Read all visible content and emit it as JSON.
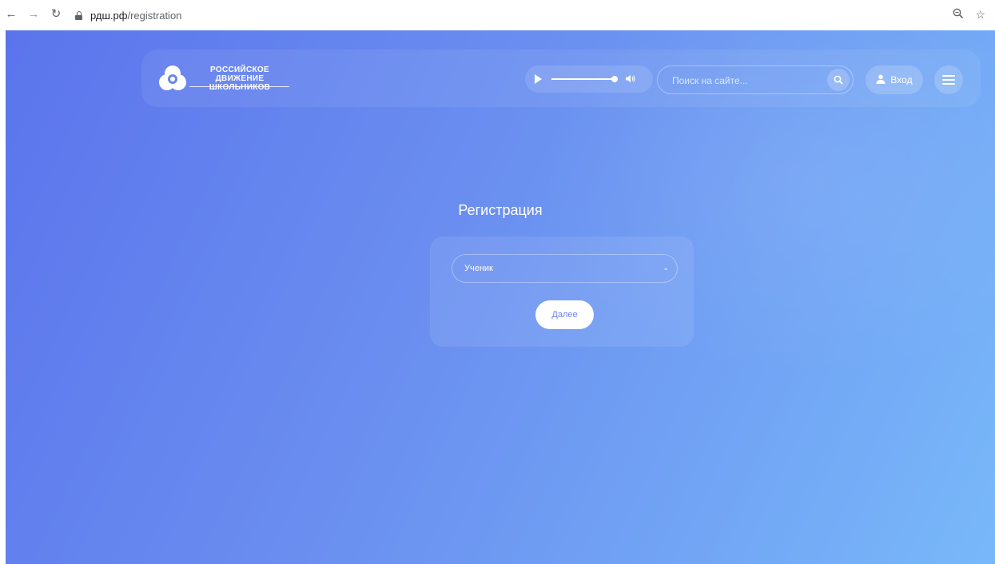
{
  "browser": {
    "url_host": "рдш.рф",
    "url_path": "/registration",
    "icons": [
      "back-arrow-icon",
      "forward-arrow-icon",
      "reload-icon",
      "lock-icon",
      "zoom-icon",
      "star-icon"
    ]
  },
  "header": {
    "logo_line1": "РОССИЙСКОЕ",
    "logo_line2": "ДВИЖЕНИЕ ШКОЛЬНИКОВ",
    "search_placeholder": "Поиск на сайте...",
    "login_label": "Вход"
  },
  "main": {
    "title": "Регистрация",
    "role_select_value": "Ученик",
    "next_button": "Далее"
  },
  "colors": {
    "gradient_start": "#5b74ec",
    "gradient_end": "#78b8f9",
    "button_text": "#6a85ee"
  }
}
